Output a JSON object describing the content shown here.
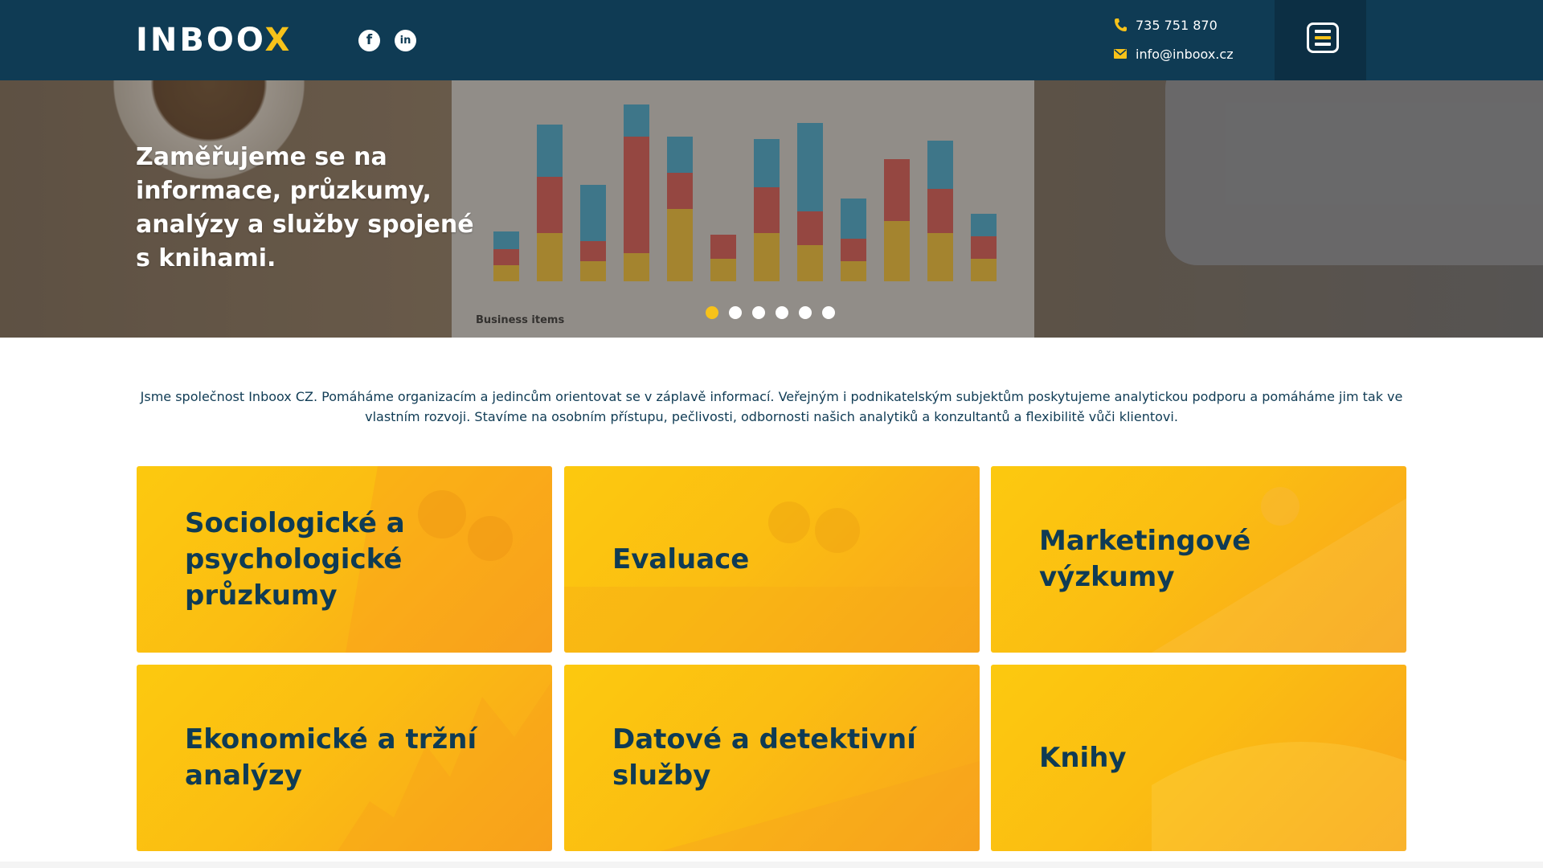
{
  "header": {
    "logo_text": "INBOO",
    "logo_accent": "X",
    "social": [
      {
        "icon": "facebook-icon",
        "glyph": "f"
      },
      {
        "icon": "linkedin-icon",
        "glyph": "in"
      }
    ],
    "phone": "735 751 870",
    "email": "info@inboox.cz",
    "menu_icon": "hamburger-menu-icon"
  },
  "hero": {
    "title": "Zaměřujeme se na informace, průzkumy, analýzy a služby spojené s knihami.",
    "slides_count": 6,
    "active_slide": 1,
    "background_chart_caption": "Business items"
  },
  "intro": {
    "text": "Jsme společnost Inboox CZ. Pomáháme organizacím a jedincům orientovat se v záplavě informací. Veřejným i podnikatelským subjektům poskytujeme analytickou podporu a pomáháme jim tak ve vlastním rozvoji. Stavíme na osobním přístupu, pečlivosti, odbornosti našich analytiků a konzultantů a flexibilitě vůči klientovi."
  },
  "services": [
    {
      "label": "Sociologické a psychologické průzkumy"
    },
    {
      "label": "Evaluace"
    },
    {
      "label": "Marketingové výzkumy"
    },
    {
      "label": "Ekonomické a tržní analýzy"
    },
    {
      "label": "Datové a detektivní služby"
    },
    {
      "label": "Knihy"
    }
  ],
  "colors": {
    "primary": "#0f3b54",
    "accent": "#f7c21a",
    "tile_gradient_start": "#fcc90f",
    "tile_gradient_end": "#f8a31d"
  }
}
